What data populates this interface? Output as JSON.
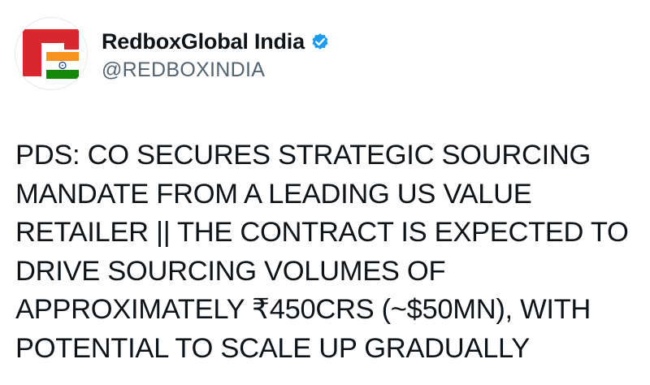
{
  "post": {
    "author": {
      "display_name": "RedboxGlobal India",
      "handle": "@REDBOXINDIA",
      "avatar_icon": "redbox-india-logo-icon",
      "verified_icon": "verified-badge-icon",
      "verified_color": "#1d9bf0"
    },
    "text_lines": [
      "PDS: CO SECURES STRATEGIC SOURCING",
      "MANDATE FROM A LEADING US VALUE",
      "RETAILER || THE CONTRACT IS EXPECTED TO",
      "DRIVE SOURCING VOLUMES OF",
      "APPROXIMATELY ₹450CRS (~$50MN), WITH",
      "POTENTIAL TO SCALE UP GRADUALLY"
    ]
  },
  "colors": {
    "brand_red": "#d7282f",
    "saffron": "#f7931e",
    "india_green": "#138808",
    "chakra_blue": "#0b3a8c",
    "text": "#0f1419",
    "muted": "#536471"
  }
}
